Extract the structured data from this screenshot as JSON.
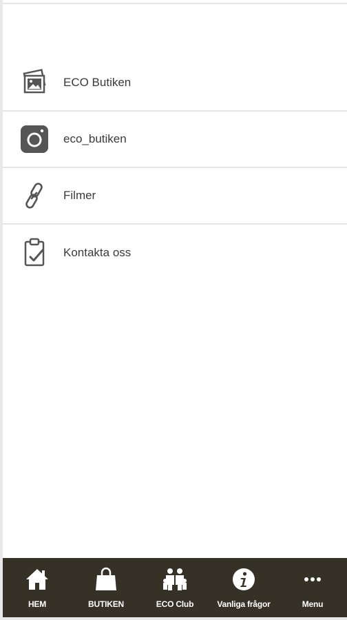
{
  "menu": {
    "items": [
      {
        "label": "ECO Butiken",
        "icon": "photo-gallery-icon"
      },
      {
        "label": "eco_butiken",
        "icon": "instagram-icon"
      },
      {
        "label": "Filmer",
        "icon": "link-icon"
      },
      {
        "label": "Kontakta oss",
        "icon": "clipboard-check-icon"
      }
    ]
  },
  "tabbar": {
    "tabs": [
      {
        "label": "HEM",
        "icon": "home-icon"
      },
      {
        "label": "BUTIKEN",
        "icon": "shopping-bag-icon"
      },
      {
        "label": "ECO Club",
        "icon": "group-icon"
      },
      {
        "label": "Vanliga frågor",
        "icon": "info-icon"
      },
      {
        "label": "Menu",
        "icon": "more-icon"
      }
    ]
  },
  "colors": {
    "tabbar_bg": "#363126",
    "icon_gray": "#555555",
    "text": "#3a3a3a"
  }
}
